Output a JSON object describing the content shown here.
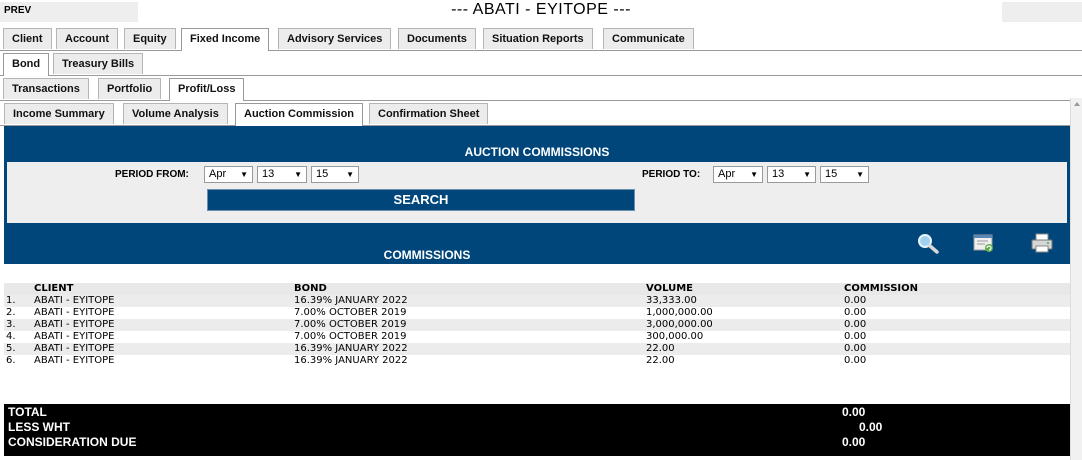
{
  "header": {
    "prev_label": "PREV",
    "client_title": "--- ABATI - EYITOPE ---"
  },
  "tabs_main": [
    "Client",
    "Account",
    "Equity",
    "Fixed Income",
    "Advisory Services",
    "Documents",
    "Situation Reports",
    "Communicate"
  ],
  "tabs_fixed_income": [
    "Bond",
    "Treasury Bills"
  ],
  "tabs_bond": [
    "Transactions",
    "Portfolio",
    "Profit/Loss"
  ],
  "tabs_profit_loss": [
    "Income Summary",
    "Volume Analysis",
    "Auction Commission",
    "Confirmation Sheet"
  ],
  "auction": {
    "title": "AUCTION COMMISSIONS",
    "period_from_label": "PERIOD FROM:",
    "period_to_label": "PERIOD TO:",
    "from": {
      "month": "Apr",
      "day": "13",
      "year": "15"
    },
    "to": {
      "month": "Apr",
      "day": "13",
      "year": "15"
    },
    "search_label": "SEARCH"
  },
  "commissions": {
    "title": "COMMISSIONS",
    "icons": [
      "search-icon",
      "export-icon",
      "print-icon"
    ],
    "columns": [
      "CLIENT",
      "BOND",
      "VOLUME",
      "COMMISSION"
    ],
    "rows": [
      {
        "num": "1.",
        "client": "ABATI - EYITOPE",
        "bond": "16.39% JANUARY 2022",
        "volume": "33,333.00",
        "commission": "0.00"
      },
      {
        "num": "2.",
        "client": "ABATI - EYITOPE",
        "bond": "7.00% OCTOBER 2019",
        "volume": "1,000,000.00",
        "commission": "0.00"
      },
      {
        "num": "3.",
        "client": "ABATI - EYITOPE",
        "bond": "7.00% OCTOBER 2019",
        "volume": "3,000,000.00",
        "commission": "0.00"
      },
      {
        "num": "4.",
        "client": "ABATI - EYITOPE",
        "bond": "7.00% OCTOBER 2019",
        "volume": "300,000.00",
        "commission": "0.00"
      },
      {
        "num": "5.",
        "client": "ABATI - EYITOPE",
        "bond": "16.39% JANUARY 2022",
        "volume": "22.00",
        "commission": "0.00"
      },
      {
        "num": "6.",
        "client": "ABATI - EYITOPE",
        "bond": "16.39% JANUARY 2022",
        "volume": "22.00",
        "commission": "0.00"
      }
    ]
  },
  "totals": {
    "total_label": "TOTAL",
    "total_value": "0.00",
    "wht_label": "LESS WHT",
    "wht_value": "0.00",
    "due_label": "CONSIDERATION DUE",
    "due_value": "0.00"
  },
  "colors": {
    "accent": "#00467a",
    "panel_grey": "#eeeeee",
    "totals_bg": "#000000"
  }
}
